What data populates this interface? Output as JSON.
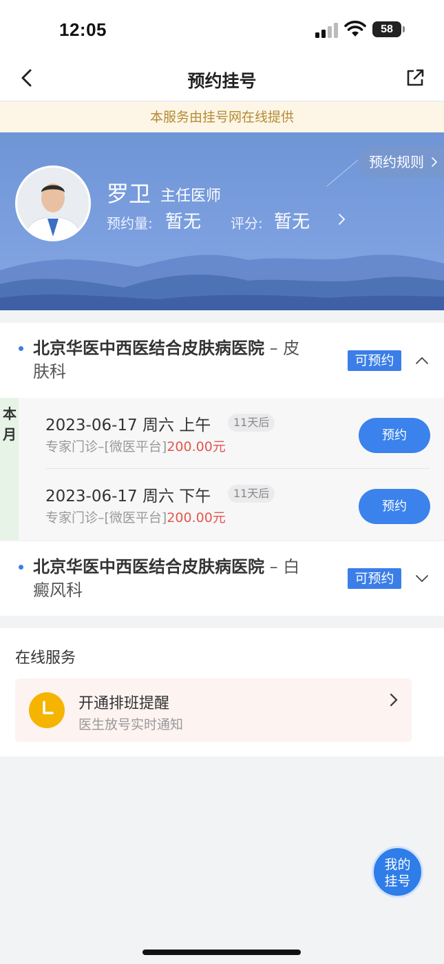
{
  "status": {
    "time": "12:05",
    "battery": "58"
  },
  "nav": {
    "title": "预约挂号",
    "back_icon": "chevron-left-icon",
    "share_icon": "share-icon"
  },
  "notice": "本服务由挂号网在线提供",
  "doctor": {
    "name": "罗卫",
    "title": "主任医师",
    "booking_label": "预约量:",
    "booking_value": "暂无",
    "rating_label": "评分:",
    "rating_value": "暂无",
    "rules_label": "预约规则"
  },
  "hospitals": [
    {
      "name": "北京华医中西医结合皮肤病医院",
      "sep": " – ",
      "dept_line1": "皮",
      "dept_line2": "肤科",
      "badge": "可预约",
      "expanded": true
    },
    {
      "name": "北京华医中西医结合皮肤病医院",
      "sep": " – ",
      "dept_line1": "白",
      "dept_line2": "癜风科",
      "badge": "可预约",
      "expanded": false
    }
  ],
  "schedule": {
    "month_label": "本月",
    "slots": [
      {
        "date": "2023-06-17 周六 上午",
        "tag": "11天后",
        "desc": "专家门诊–[微医平台]",
        "price": "200.00元",
        "button": "预约"
      },
      {
        "date": "2023-06-17 周六 下午",
        "tag": "11天后",
        "desc": "专家门诊–[微医平台]",
        "price": "200.00元",
        "button": "预约"
      }
    ]
  },
  "online_service": {
    "title": "在线服务",
    "card_title": "开通排班提醒",
    "card_subtitle": "医生放号实时通知"
  },
  "fab": {
    "line1": "我的",
    "line2": "挂号"
  },
  "colors": {
    "primary": "#3b7ee8",
    "price": "#e2574c",
    "notice_bg": "#fdf6e7",
    "notice_text": "#b58a33",
    "clock": "#f5b400"
  }
}
